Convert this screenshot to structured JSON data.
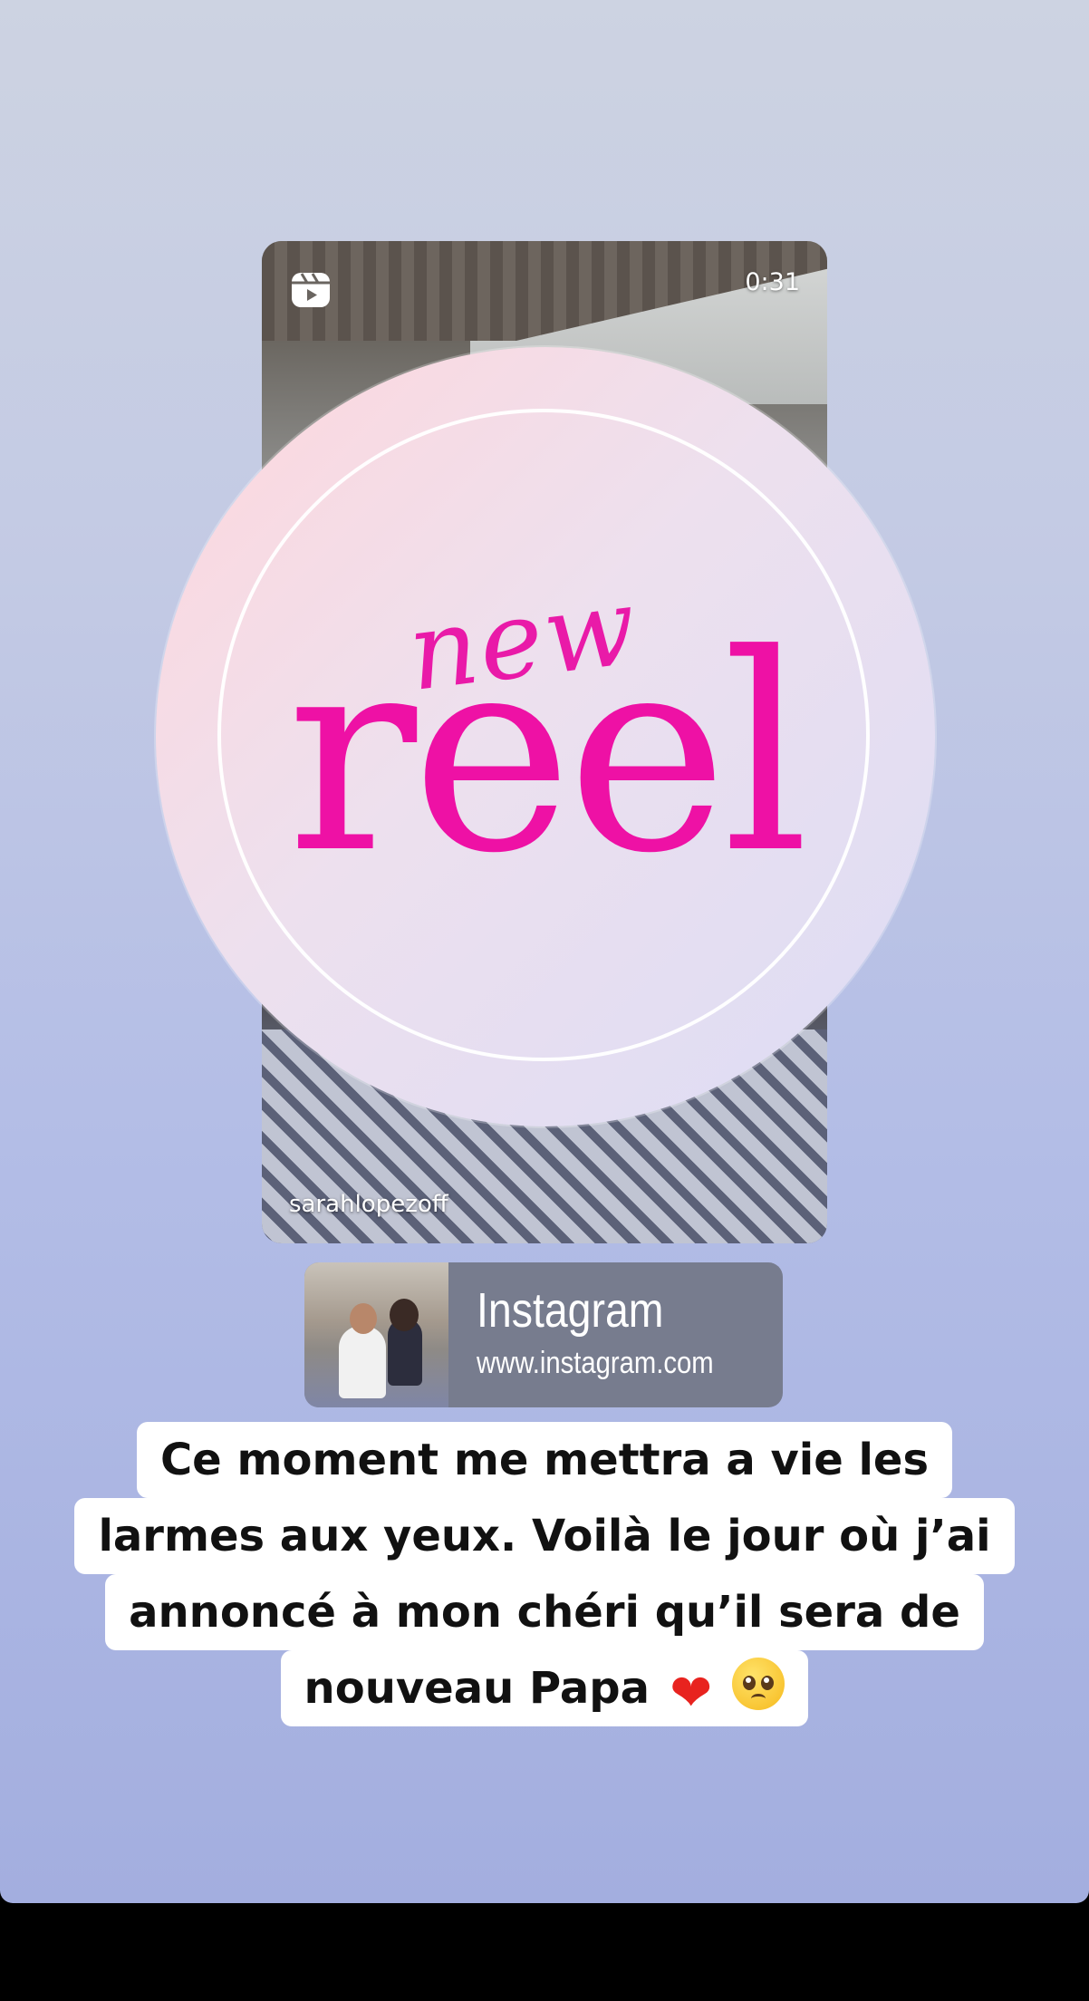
{
  "reel": {
    "duration": "0:31",
    "username": "sarahlopezoff",
    "icon": "reels-icon"
  },
  "sticker": {
    "line1": "new",
    "line2": "reel"
  },
  "link_sticker": {
    "title": "Instagram",
    "url": "www.instagram.com"
  },
  "caption": {
    "lines": [
      "Ce moment me mettra a vie les",
      "larmes aux yeux. Voilà le jour où j’ai",
      "annoncé à mon chéri qu’il sera de",
      "nouveau Papa"
    ],
    "emojis": [
      "red-heart-icon",
      "pleading-face-icon"
    ]
  },
  "colors": {
    "accent_pink": "#ee11a5",
    "link_bg": "#777c8e"
  }
}
